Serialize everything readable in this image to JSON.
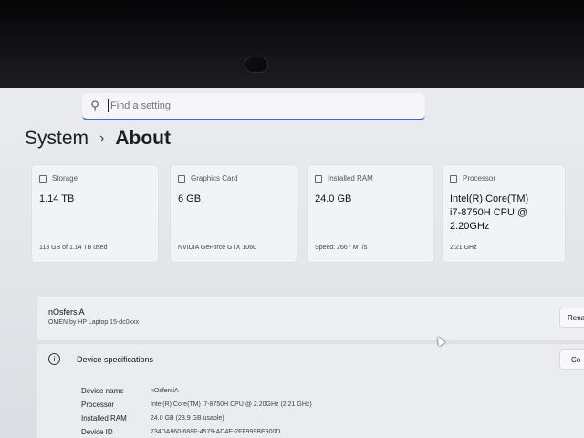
{
  "search": {
    "placeholder": "Find a setting"
  },
  "breadcrumb": {
    "parent": "System",
    "separator": "›",
    "current": "About"
  },
  "cards": [
    {
      "title": "Storage",
      "value": "1.14 TB",
      "sub": "113 GB of 1.14 TB used",
      "icon": "storage-icon"
    },
    {
      "title": "Graphics Card",
      "value": "6 GB",
      "sub": "NVIDIA GeForce GTX 1060",
      "icon": "graphics-card-icon"
    },
    {
      "title": "Installed RAM",
      "value": "24.0 GB",
      "sub": "Speed: 2667 MT/s",
      "icon": "ram-icon"
    },
    {
      "title": "Processor",
      "value": "Intel(R) Core(TM) i7-8750H CPU @ 2.20GHz",
      "sub": "2.21 GHz",
      "icon": "processor-icon"
    }
  ],
  "device": {
    "name": "nOsfersiA",
    "model": "OMEN by HP Laptop 15-dc0xxx",
    "rename_label": "Rena"
  },
  "specs": {
    "title": "Device specifications",
    "copy_label": "Co",
    "rows": [
      {
        "key": "Device name",
        "value": "nOsfersiA"
      },
      {
        "key": "Processor",
        "value": "Intel(R) Core(TM) i7-8750H CPU @ 2.20GHz (2.21 GHz)"
      },
      {
        "key": "Installed RAM",
        "value": "24.0 GB (23.9 GB usable)"
      },
      {
        "key": "Device ID",
        "value": "734DA960-688F-4579-AD4E-2FF999BE900D"
      }
    ]
  },
  "colors": {
    "accent": "#3b6cc8"
  }
}
